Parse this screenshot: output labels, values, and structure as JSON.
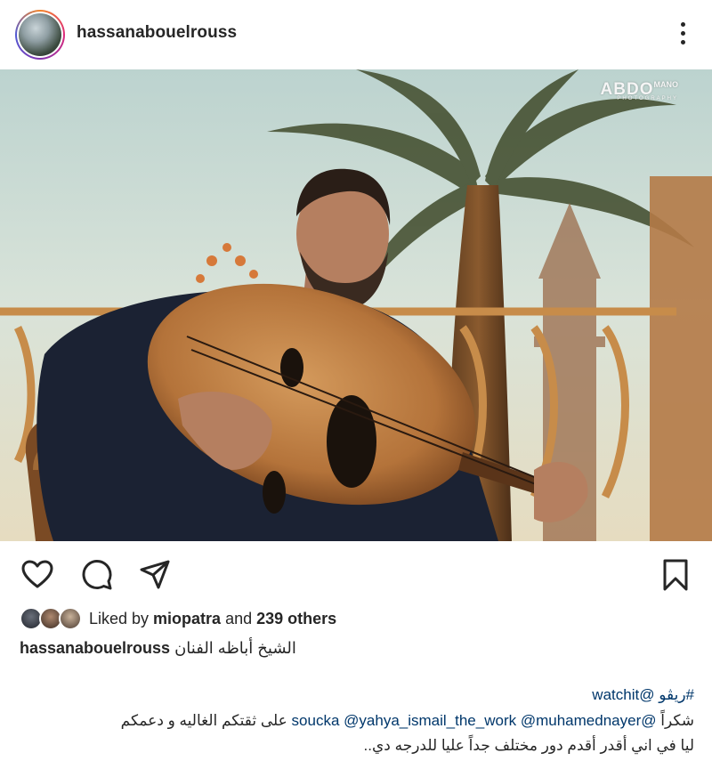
{
  "post": {
    "username": "hassanabouelrouss",
    "more_icon": "more-vertical-icon"
  },
  "photo": {
    "watermark_main": "ABDO",
    "watermark_small": "MANO",
    "watermark_sub": "PHOTOGRAPHY"
  },
  "actions": {
    "like_icon": "heart-icon",
    "comment_icon": "comment-icon",
    "share_icon": "send-icon",
    "save_icon": "bookmark-icon"
  },
  "likes": {
    "prefix": "Liked by ",
    "user": "miopatra",
    "middle": " and ",
    "others": "239 others"
  },
  "caption": {
    "username": "hassanabouelrouss",
    "text": "الشيخ أباظه الفنان"
  },
  "comment": {
    "hashtag": "#ريڤو",
    "mention_watchit": "@watchit",
    "thanks": "شكراً",
    "mention_soucka": "@soucka",
    "mention_yahya": "@yahya_ismail_the_work",
    "mention_muhamed": "@muhamednayer",
    "line2_tail": "على ثقتكم الغاليه و دعمكم",
    "line3": "ليا في اني أقدر أقدم دور مختلف جداً عليا للدرجه دي.."
  },
  "colors": {
    "text": "#262626",
    "link": "#00376b",
    "background": "#ffffff"
  }
}
